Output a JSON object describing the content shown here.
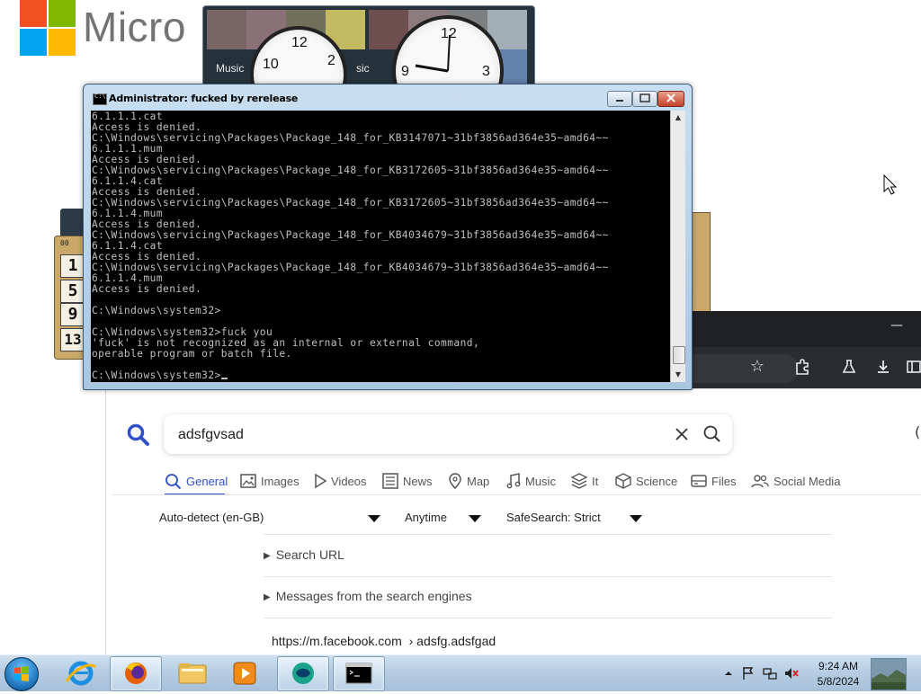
{
  "desktop": {
    "brand_text": "Micro",
    "gadget_caption_1": "Music",
    "gadget_caption_2": "sic",
    "clock_nums": [
      "12",
      "2",
      "10",
      "12",
      "9",
      "3"
    ],
    "calc_numbers": [
      "1",
      "5",
      "9",
      "13"
    ],
    "calc_top": "00"
  },
  "cmd": {
    "title": "Administrator: fucked by rerelease",
    "icon_text": "C:\\",
    "lines": [
      "6.1.1.1.cat",
      "Access is denied.",
      "C:\\Windows\\servicing\\Packages\\Package_148_for_KB3147071~31bf3856ad364e35~amd64~~",
      "6.1.1.1.mum",
      "Access is denied.",
      "C:\\Windows\\servicing\\Packages\\Package_148_for_KB3172605~31bf3856ad364e35~amd64~~",
      "6.1.1.4.cat",
      "Access is denied.",
      "C:\\Windows\\servicing\\Packages\\Package_148_for_KB3172605~31bf3856ad364e35~amd64~~",
      "6.1.1.4.mum",
      "Access is denied.",
      "C:\\Windows\\servicing\\Packages\\Package_148_for_KB4034679~31bf3856ad364e35~amd64~~",
      "6.1.1.4.cat",
      "Access is denied.",
      "C:\\Windows\\servicing\\Packages\\Package_148_for_KB4034679~31bf3856ad364e35~amd64~~",
      "6.1.1.4.mum",
      "Access is denied.",
      "",
      "C:\\Windows\\system32>",
      "",
      "C:\\Windows\\system32>fuck you",
      "'fuck' is not recognized as an internal or external command,",
      "operable program or batch file.",
      "",
      "C:\\Windows\\system32>"
    ]
  },
  "browser": {
    "search_value": "adsfgvsad",
    "categories": [
      {
        "label": "General",
        "icon": "search-icon"
      },
      {
        "label": "Images",
        "icon": "image-icon"
      },
      {
        "label": "Videos",
        "icon": "play-icon"
      },
      {
        "label": "News",
        "icon": "newspaper-icon"
      },
      {
        "label": "Map",
        "icon": "map-pin-icon"
      },
      {
        "label": "Music",
        "icon": "music-note-icon"
      },
      {
        "label": "It",
        "icon": "layers-icon"
      },
      {
        "label": "Science",
        "icon": "cube-icon"
      },
      {
        "label": "Files",
        "icon": "drive-icon"
      },
      {
        "label": "Social Media",
        "icon": "people-icon"
      }
    ],
    "filters": {
      "language": "Auto-detect (en-GB)",
      "time": "Anytime",
      "safesearch": "SafeSearch: Strict"
    },
    "expanders": [
      "Search URL",
      "Messages from the search engines"
    ],
    "result": {
      "url": "https://m.facebook.com",
      "path": "› adsfg.adsfgad"
    },
    "window_min": "—"
  },
  "taskbar": {
    "time": "9:24 AM",
    "date": "5/8/2024",
    "apps": [
      "internet-explorer-icon",
      "firefox-icon",
      "file-explorer-icon",
      "media-player-icon",
      "messenger-icon",
      "command-prompt-icon"
    ]
  },
  "colors": {
    "accent": "#3050c8",
    "cmd_text": "#c0c0c0",
    "cmd_bg": "#000000"
  }
}
